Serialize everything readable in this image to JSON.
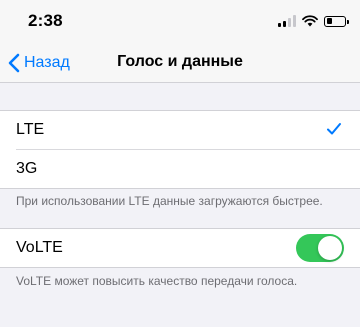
{
  "status_bar": {
    "time": "2:38",
    "signal_bars_active": 2,
    "signal_bars_total": 4,
    "battery_level": 0.3,
    "icons": [
      "cellular-signal-icon",
      "wifi-icon",
      "battery-icon"
    ]
  },
  "nav": {
    "back_label": "Назад",
    "title": "Голос и данные"
  },
  "network_group": {
    "options": [
      {
        "label": "LTE",
        "selected": true
      },
      {
        "label": "3G",
        "selected": false
      }
    ],
    "footer": "При использовании LTE данные загружаются быстрее."
  },
  "volte_group": {
    "label": "VoLTE",
    "enabled": true,
    "footer": "VoLTE может повысить качество передачи голоса."
  },
  "colors": {
    "accent": "#007aff",
    "toggle_on": "#34c759",
    "background": "#f2f2f7"
  }
}
